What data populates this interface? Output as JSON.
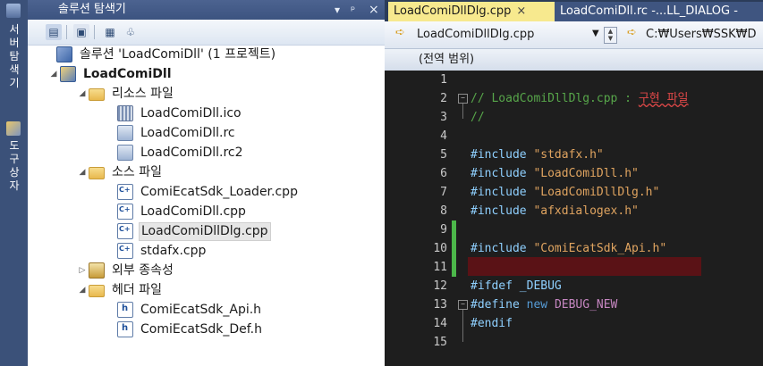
{
  "side_strip": {
    "tab1": "서버 탐색기",
    "tab2": "도구 상자"
  },
  "explorer": {
    "title": "솔루션 탐색기",
    "pin_glyph": "ᵖ",
    "close_glyph": "×",
    "tree": [
      {
        "label": "솔루션 'LoadComiDll' (1 프로젝트)",
        "icon": "solution-icon"
      },
      {
        "label": "LoadComiDll",
        "icon": "project-icon",
        "bold": true
      },
      {
        "label": "리소스 파일",
        "icon": "folder-icon"
      },
      {
        "label": "LoadComiDll.ico",
        "icon": "ico-file-icon"
      },
      {
        "label": "LoadComiDll.rc",
        "icon": "rc-file-icon"
      },
      {
        "label": "LoadComiDll.rc2",
        "icon": "rc-file-icon"
      },
      {
        "label": "소스 파일",
        "icon": "folder-icon"
      },
      {
        "label": "ComiEcatSdk_Loader.cpp",
        "icon": "cpp-file-icon"
      },
      {
        "label": "LoadComiDll.cpp",
        "icon": "cpp-file-icon"
      },
      {
        "label": "LoadComiDllDlg.cpp",
        "icon": "cpp-file-icon",
        "selected": true
      },
      {
        "label": "stdafx.cpp",
        "icon": "cpp-file-icon"
      },
      {
        "label": "외부 종속성",
        "icon": "external-deps-icon"
      },
      {
        "label": "헤더 파일",
        "icon": "folder-icon"
      },
      {
        "label": "ComiEcatSdk_Api.h",
        "icon": "header-file-icon"
      },
      {
        "label": "ComiEcatSdk_Def.h",
        "icon": "header-file-icon"
      }
    ]
  },
  "editor": {
    "tabs": [
      {
        "label": "LoadComiDllDlg.cpp",
        "close": "×",
        "active": true
      },
      {
        "label": "LoadComiDll.rc -...LL_DIALOG -",
        "active": false
      }
    ],
    "nav_file": "LoadComiDllDlg.cpp",
    "nav_path": "C:₩Users₩SSK₩D",
    "scope": "(전역 범위)",
    "lines": [
      {
        "n": "1",
        "parts": []
      },
      {
        "n": "2",
        "parts": [
          {
            "t": "// LoadComiDllDlg.cpp : ",
            "c": "k-comment"
          },
          {
            "t": "구현 파일",
            "c": "k-red"
          }
        ]
      },
      {
        "n": "3",
        "parts": [
          {
            "t": "//",
            "c": "k-comment"
          }
        ]
      },
      {
        "n": "4",
        "parts": []
      },
      {
        "n": "5",
        "parts": [
          {
            "t": "#include ",
            "c": "k-pp"
          },
          {
            "t": "\"stdafx.h\"",
            "c": "k-str"
          }
        ]
      },
      {
        "n": "6",
        "parts": [
          {
            "t": "#include ",
            "c": "k-pp"
          },
          {
            "t": "\"LoadComiDll.h\"",
            "c": "k-str"
          }
        ]
      },
      {
        "n": "7",
        "parts": [
          {
            "t": "#include ",
            "c": "k-pp"
          },
          {
            "t": "\"LoadComiDllDlg.h\"",
            "c": "k-str"
          }
        ]
      },
      {
        "n": "8",
        "parts": [
          {
            "t": "#include ",
            "c": "k-pp"
          },
          {
            "t": "\"afxdialogex.h\"",
            "c": "k-str"
          }
        ]
      },
      {
        "n": "9",
        "parts": []
      },
      {
        "n": "10",
        "parts": [
          {
            "t": "#include ",
            "c": "k-pp"
          },
          {
            "t": "\"ComiEcatSdk_Api.h\"",
            "c": "k-str"
          }
        ]
      },
      {
        "n": "11",
        "parts": []
      },
      {
        "n": "12",
        "parts": [
          {
            "t": "#ifdef _DEBUG",
            "c": "k-pp"
          }
        ]
      },
      {
        "n": "13",
        "parts": [
          {
            "t": "#define ",
            "c": "k-pp"
          },
          {
            "t": "new ",
            "c": "k-kw"
          },
          {
            "t": "DEBUG_NEW",
            "c": "k-macro"
          }
        ]
      },
      {
        "n": "14",
        "parts": [
          {
            "t": "#endif",
            "c": "k-pp"
          }
        ]
      },
      {
        "n": "15",
        "parts": []
      }
    ]
  }
}
